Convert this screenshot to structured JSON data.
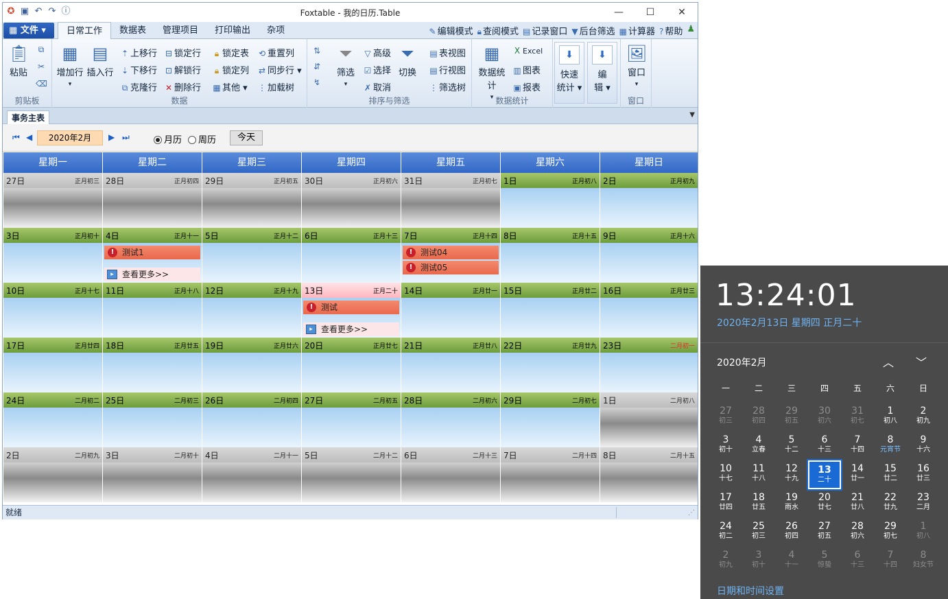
{
  "window": {
    "title": "Foxtable - 我的日历.Table"
  },
  "ribbon": {
    "file_label": "文件",
    "tabs": [
      "日常工作",
      "数据表",
      "管理项目",
      "打印输出",
      "杂项"
    ],
    "toplinks": [
      "编辑模式",
      "查阅模式",
      "记录窗口",
      "后台筛选",
      "计算器",
      "帮助"
    ],
    "groups": {
      "clipboard": {
        "label": "剪贴板",
        "paste": "粘贴"
      },
      "data": {
        "label": "数据",
        "add_row": "增加行",
        "insert_row": "插入行",
        "move_up": "上移行",
        "move_down": "下移行",
        "clone_row": "克隆行",
        "lock_row": "锁定行",
        "unlock_row": "解锁行",
        "delete_row": "删除行",
        "lock_table": "锁定表",
        "lock_col": "锁定列",
        "other": "其他",
        "reset_col": "重置列",
        "sync_row": "同步行",
        "load_tree": "加载树"
      },
      "sort": {
        "label": "排序与筛选",
        "filter": "筛选",
        "advanced": "高级",
        "select": "选择",
        "cancel": "取消",
        "switch": "切换",
        "table_view": "表视图",
        "row_view": "行视图",
        "filter_tree": "筛选树"
      },
      "stats": {
        "label": "数据统计",
        "data_stats": "数据统计",
        "excel": "Excel",
        "chart": "图表",
        "report": "报表"
      },
      "quick": {
        "label1": "快速",
        "label2": "统计"
      },
      "edit": {
        "label1": "编",
        "label2": "辑"
      },
      "window": {
        "label": "窗口",
        "btn": "窗口"
      }
    }
  },
  "doc_tab": "事务主表",
  "nav": {
    "month": "2020年2月",
    "month_view": "月历",
    "week_view": "周历",
    "today": "今天"
  },
  "calendar": {
    "weekdays": [
      "星期一",
      "星期二",
      "星期三",
      "星期四",
      "星期五",
      "星期六",
      "星期日"
    ],
    "weeks": [
      [
        [
          "27日",
          "正月初三",
          "out"
        ],
        [
          "28日",
          "正月初四",
          "out"
        ],
        [
          "29日",
          "正月初五",
          "out"
        ],
        [
          "30日",
          "正月初六",
          "out"
        ],
        [
          "31日",
          "正月初七",
          "out"
        ],
        [
          "1日",
          "正月初八",
          "in"
        ],
        [
          "2日",
          "正月初九",
          "in"
        ]
      ],
      [
        [
          "3日",
          "正月初十",
          "in"
        ],
        [
          "4日",
          "正月十一",
          "in"
        ],
        [
          "5日",
          "正月十二",
          "in"
        ],
        [
          "6日",
          "正月十三",
          "in"
        ],
        [
          "7日",
          "正月十四",
          "in"
        ],
        [
          "8日",
          "正月十五",
          "in"
        ],
        [
          "9日",
          "正月十六",
          "in"
        ]
      ],
      [
        [
          "10日",
          "正月十七",
          "in"
        ],
        [
          "11日",
          "正月十八",
          "in"
        ],
        [
          "12日",
          "正月十九",
          "in"
        ],
        [
          "13日",
          "正月二十",
          "today"
        ],
        [
          "14日",
          "正月廿一",
          "in"
        ],
        [
          "15日",
          "正月廿二",
          "in"
        ],
        [
          "16日",
          "正月廿三",
          "in"
        ]
      ],
      [
        [
          "17日",
          "正月廿四",
          "in"
        ],
        [
          "18日",
          "正月廿五",
          "in"
        ],
        [
          "19日",
          "正月廿六",
          "in"
        ],
        [
          "20日",
          "正月廿七",
          "in"
        ],
        [
          "21日",
          "正月廿八",
          "in"
        ],
        [
          "22日",
          "正月廿九",
          "in"
        ],
        [
          "23日",
          "二月初一",
          "in-red"
        ]
      ],
      [
        [
          "24日",
          "二月初二",
          "in"
        ],
        [
          "25日",
          "二月初三",
          "in"
        ],
        [
          "26日",
          "二月初四",
          "in"
        ],
        [
          "27日",
          "二月初五",
          "in"
        ],
        [
          "28日",
          "二月初六",
          "in"
        ],
        [
          "29日",
          "二月初七",
          "in"
        ],
        [
          "1日",
          "二月初八",
          "out"
        ]
      ],
      [
        [
          "2日",
          "二月初九",
          "out"
        ],
        [
          "3日",
          "二月初十",
          "out"
        ],
        [
          "4日",
          "二月十一",
          "out"
        ],
        [
          "5日",
          "二月十二",
          "out"
        ],
        [
          "6日",
          "二月十三",
          "out"
        ],
        [
          "7日",
          "二月十四",
          "out"
        ],
        [
          "8日",
          "二月十五",
          "out"
        ]
      ]
    ],
    "events": {
      "w1d1": [
        "测试1"
      ],
      "w1d4": [
        "测试04",
        "测试05"
      ],
      "w2d3": [
        "测试"
      ]
    },
    "more_label": "查看更多>>"
  },
  "status": {
    "text": "就绪"
  },
  "flyout": {
    "time": "13:24:01",
    "long_date": "2020年2月13日 星期四 正月二十",
    "month": "2020年2月",
    "weekdays": [
      "一",
      "二",
      "三",
      "四",
      "五",
      "六",
      "日"
    ],
    "rows": [
      [
        [
          "27",
          "初三",
          "dim"
        ],
        [
          "28",
          "初四",
          "dim"
        ],
        [
          "29",
          "初五",
          "dim"
        ],
        [
          "30",
          "初六",
          "dim"
        ],
        [
          "31",
          "初七",
          "dim"
        ],
        [
          "1",
          "初八",
          "cur"
        ],
        [
          "2",
          "初九",
          "cur"
        ]
      ],
      [
        [
          "3",
          "初十",
          "cur"
        ],
        [
          "4",
          "立春",
          "cur"
        ],
        [
          "5",
          "十二",
          "cur"
        ],
        [
          "6",
          "十三",
          "cur"
        ],
        [
          "7",
          "十四",
          "cur"
        ],
        [
          "8",
          "元宵节",
          "blue"
        ],
        [
          "9",
          "十六",
          "cur"
        ]
      ],
      [
        [
          "10",
          "十七",
          "cur"
        ],
        [
          "11",
          "十八",
          "cur"
        ],
        [
          "12",
          "十九",
          "cur"
        ],
        [
          "13",
          "二十",
          "sel"
        ],
        [
          "14",
          "廿一",
          "cur"
        ],
        [
          "15",
          "廿二",
          "cur"
        ],
        [
          "16",
          "廿三",
          "cur"
        ]
      ],
      [
        [
          "17",
          "廿四",
          "cur"
        ],
        [
          "18",
          "廿五",
          "cur"
        ],
        [
          "19",
          "雨水",
          "cur"
        ],
        [
          "20",
          "廿七",
          "cur"
        ],
        [
          "21",
          "廿八",
          "cur"
        ],
        [
          "22",
          "廿九",
          "cur"
        ],
        [
          "23",
          "二月",
          "cur"
        ]
      ],
      [
        [
          "24",
          "初二",
          "cur"
        ],
        [
          "25",
          "初三",
          "cur"
        ],
        [
          "26",
          "初四",
          "cur"
        ],
        [
          "27",
          "初五",
          "cur"
        ],
        [
          "28",
          "初六",
          "cur"
        ],
        [
          "29",
          "初七",
          "cur"
        ],
        [
          "1",
          "初八",
          "dim"
        ]
      ],
      [
        [
          "2",
          "初九",
          "dim"
        ],
        [
          "3",
          "初十",
          "dim"
        ],
        [
          "4",
          "十一",
          "dim"
        ],
        [
          "5",
          "惊蛰",
          "dim"
        ],
        [
          "6",
          "十三",
          "dim"
        ],
        [
          "7",
          "十四",
          "dim"
        ],
        [
          "8",
          "妇女节",
          "dim"
        ]
      ]
    ],
    "settings_link": "日期和时间设置"
  }
}
